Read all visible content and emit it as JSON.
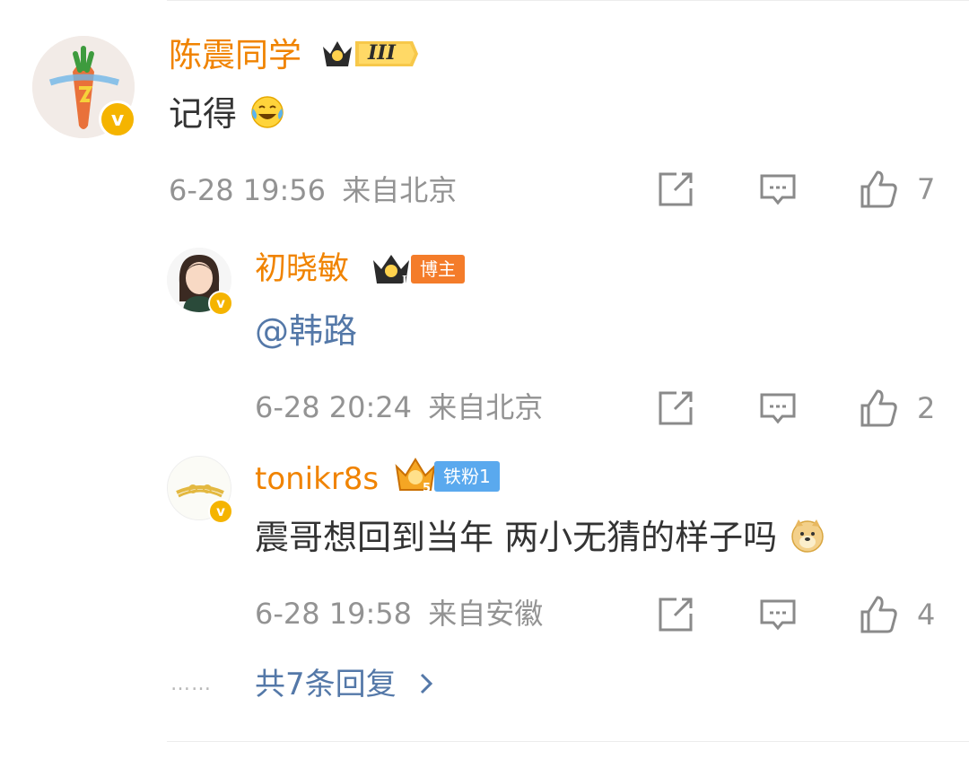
{
  "comment": {
    "username": "陈震同学",
    "level_badge": "III",
    "text": "记得",
    "emoji": "laugh-cry-emoji",
    "timestamp": "6-28 19:56",
    "location": "来自北京",
    "likes": "7"
  },
  "replies": [
    {
      "username": "初晓敏",
      "level_badge": "II",
      "tag": "博主",
      "text": "@韩路",
      "timestamp": "6-28 20:24",
      "location": "来自北京",
      "likes": "2"
    },
    {
      "username": "tonikr8s",
      "level_badge": "5",
      "tag": "铁粉1",
      "text": "震哥想回到当年 两小无猜的样子吗",
      "emoji": "doge-emoji",
      "timestamp": "6-28 19:58",
      "location": "来自安徽",
      "likes": "4"
    }
  ],
  "more_replies": {
    "dots": "……",
    "label": "共7条回复"
  },
  "colors": {
    "username": "#f08300",
    "mention": "#5478a8",
    "meta": "#939393",
    "verified_badge": "#f5b400"
  }
}
